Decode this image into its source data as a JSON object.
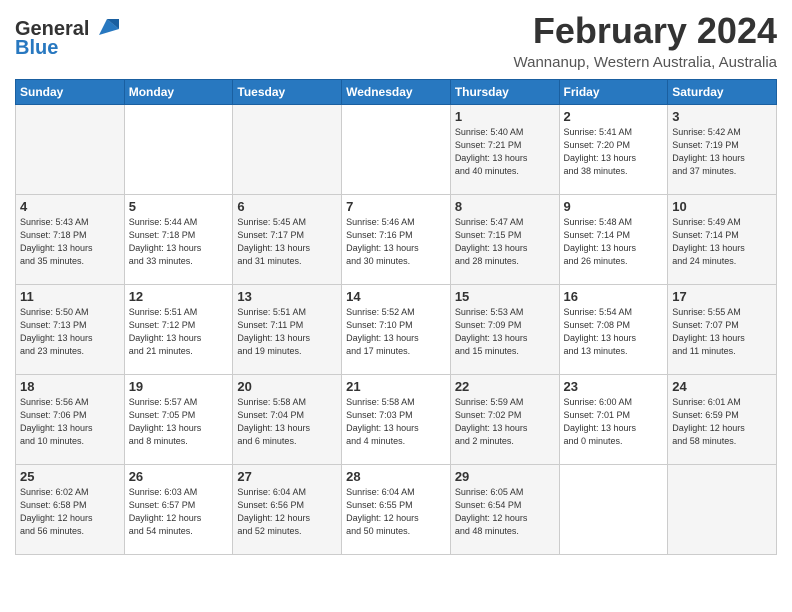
{
  "header": {
    "logo_line1": "General",
    "logo_line2": "Blue",
    "month": "February 2024",
    "location": "Wannanup, Western Australia, Australia"
  },
  "days_of_week": [
    "Sunday",
    "Monday",
    "Tuesday",
    "Wednesday",
    "Thursday",
    "Friday",
    "Saturday"
  ],
  "weeks": [
    [
      {
        "day": "",
        "info": ""
      },
      {
        "day": "",
        "info": ""
      },
      {
        "day": "",
        "info": ""
      },
      {
        "day": "",
        "info": ""
      },
      {
        "day": "1",
        "info": "Sunrise: 5:40 AM\nSunset: 7:21 PM\nDaylight: 13 hours\nand 40 minutes."
      },
      {
        "day": "2",
        "info": "Sunrise: 5:41 AM\nSunset: 7:20 PM\nDaylight: 13 hours\nand 38 minutes."
      },
      {
        "day": "3",
        "info": "Sunrise: 5:42 AM\nSunset: 7:19 PM\nDaylight: 13 hours\nand 37 minutes."
      }
    ],
    [
      {
        "day": "4",
        "info": "Sunrise: 5:43 AM\nSunset: 7:18 PM\nDaylight: 13 hours\nand 35 minutes."
      },
      {
        "day": "5",
        "info": "Sunrise: 5:44 AM\nSunset: 7:18 PM\nDaylight: 13 hours\nand 33 minutes."
      },
      {
        "day": "6",
        "info": "Sunrise: 5:45 AM\nSunset: 7:17 PM\nDaylight: 13 hours\nand 31 minutes."
      },
      {
        "day": "7",
        "info": "Sunrise: 5:46 AM\nSunset: 7:16 PM\nDaylight: 13 hours\nand 30 minutes."
      },
      {
        "day": "8",
        "info": "Sunrise: 5:47 AM\nSunset: 7:15 PM\nDaylight: 13 hours\nand 28 minutes."
      },
      {
        "day": "9",
        "info": "Sunrise: 5:48 AM\nSunset: 7:14 PM\nDaylight: 13 hours\nand 26 minutes."
      },
      {
        "day": "10",
        "info": "Sunrise: 5:49 AM\nSunset: 7:14 PM\nDaylight: 13 hours\nand 24 minutes."
      }
    ],
    [
      {
        "day": "11",
        "info": "Sunrise: 5:50 AM\nSunset: 7:13 PM\nDaylight: 13 hours\nand 23 minutes."
      },
      {
        "day": "12",
        "info": "Sunrise: 5:51 AM\nSunset: 7:12 PM\nDaylight: 13 hours\nand 21 minutes."
      },
      {
        "day": "13",
        "info": "Sunrise: 5:51 AM\nSunset: 7:11 PM\nDaylight: 13 hours\nand 19 minutes."
      },
      {
        "day": "14",
        "info": "Sunrise: 5:52 AM\nSunset: 7:10 PM\nDaylight: 13 hours\nand 17 minutes."
      },
      {
        "day": "15",
        "info": "Sunrise: 5:53 AM\nSunset: 7:09 PM\nDaylight: 13 hours\nand 15 minutes."
      },
      {
        "day": "16",
        "info": "Sunrise: 5:54 AM\nSunset: 7:08 PM\nDaylight: 13 hours\nand 13 minutes."
      },
      {
        "day": "17",
        "info": "Sunrise: 5:55 AM\nSunset: 7:07 PM\nDaylight: 13 hours\nand 11 minutes."
      }
    ],
    [
      {
        "day": "18",
        "info": "Sunrise: 5:56 AM\nSunset: 7:06 PM\nDaylight: 13 hours\nand 10 minutes."
      },
      {
        "day": "19",
        "info": "Sunrise: 5:57 AM\nSunset: 7:05 PM\nDaylight: 13 hours\nand 8 minutes."
      },
      {
        "day": "20",
        "info": "Sunrise: 5:58 AM\nSunset: 7:04 PM\nDaylight: 13 hours\nand 6 minutes."
      },
      {
        "day": "21",
        "info": "Sunrise: 5:58 AM\nSunset: 7:03 PM\nDaylight: 13 hours\nand 4 minutes."
      },
      {
        "day": "22",
        "info": "Sunrise: 5:59 AM\nSunset: 7:02 PM\nDaylight: 13 hours\nand 2 minutes."
      },
      {
        "day": "23",
        "info": "Sunrise: 6:00 AM\nSunset: 7:01 PM\nDaylight: 13 hours\nand 0 minutes."
      },
      {
        "day": "24",
        "info": "Sunrise: 6:01 AM\nSunset: 6:59 PM\nDaylight: 12 hours\nand 58 minutes."
      }
    ],
    [
      {
        "day": "25",
        "info": "Sunrise: 6:02 AM\nSunset: 6:58 PM\nDaylight: 12 hours\nand 56 minutes."
      },
      {
        "day": "26",
        "info": "Sunrise: 6:03 AM\nSunset: 6:57 PM\nDaylight: 12 hours\nand 54 minutes."
      },
      {
        "day": "27",
        "info": "Sunrise: 6:04 AM\nSunset: 6:56 PM\nDaylight: 12 hours\nand 52 minutes."
      },
      {
        "day": "28",
        "info": "Sunrise: 6:04 AM\nSunset: 6:55 PM\nDaylight: 12 hours\nand 50 minutes."
      },
      {
        "day": "29",
        "info": "Sunrise: 6:05 AM\nSunset: 6:54 PM\nDaylight: 12 hours\nand 48 minutes."
      },
      {
        "day": "",
        "info": ""
      },
      {
        "day": "",
        "info": ""
      }
    ]
  ]
}
